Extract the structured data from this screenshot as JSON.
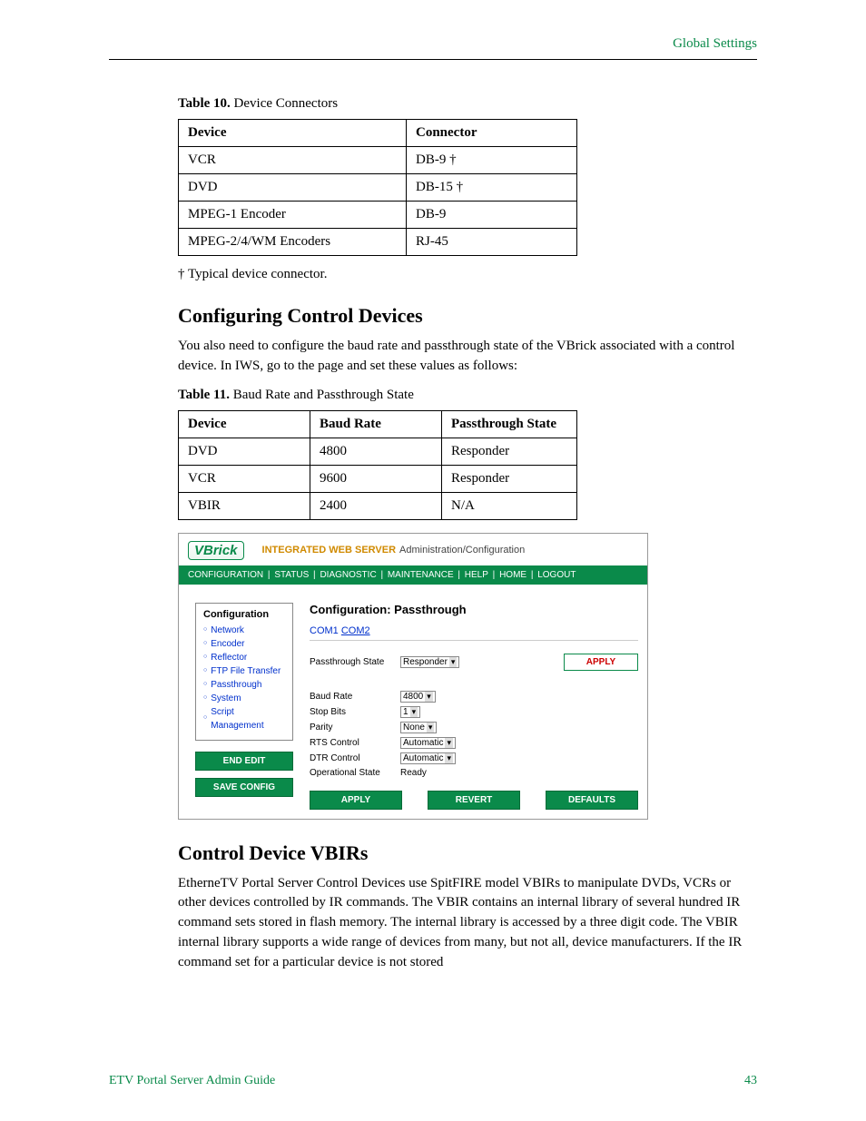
{
  "header": {
    "section": "Global Settings"
  },
  "table10": {
    "caption_prefix": "Table 10.",
    "caption": "Device Connectors",
    "cols": [
      "Device",
      "Connector"
    ],
    "rows": [
      [
        "VCR",
        "DB-9 †"
      ],
      [
        "DVD",
        "DB-15 †"
      ],
      [
        "MPEG-1 Encoder",
        "DB-9"
      ],
      [
        "MPEG-2/4/WM Encoders",
        "RJ-45"
      ]
    ],
    "footnote": "†   Typical device connector."
  },
  "section1": {
    "title": "Configuring Control Devices",
    "para": "You also need to configure the baud rate and passthrough state of the VBrick associated with a control device. In IWS, go to the                                                           page and set these values as follows:"
  },
  "table11": {
    "caption_prefix": "Table 11.",
    "caption": "Baud Rate and Passthrough State",
    "cols": [
      "Device",
      "Baud Rate",
      "Passthrough State"
    ],
    "rows": [
      [
        "DVD",
        "4800",
        "Responder"
      ],
      [
        "VCR",
        "9600",
        "Responder"
      ],
      [
        "VBIR",
        "2400",
        "N/A"
      ]
    ]
  },
  "screenshot": {
    "logo": "VBrick",
    "title1": "INTEGRATED WEB SERVER",
    "title2": "Administration/Configuration",
    "menu": [
      "CONFIGURATION",
      "STATUS",
      "DIAGNOSTIC",
      "MAINTENANCE",
      "HELP",
      "HOME",
      "LOGOUT"
    ],
    "sidebar": {
      "title": "Configuration",
      "items": [
        "Network",
        "Encoder",
        "Reflector",
        "FTP File Transfer",
        "Passthrough",
        "System",
        "Script Management"
      ],
      "btn_end_edit": "END EDIT",
      "btn_save_config": "SAVE CONFIG"
    },
    "main": {
      "heading": "Configuration: Passthrough",
      "tabs": {
        "t1": "COM1",
        "t2": "COM2"
      },
      "pass_label": "Passthrough State",
      "pass_value": "Responder",
      "apply": "APPLY",
      "fields": [
        {
          "label": "Baud Rate",
          "value": "4800",
          "type": "select"
        },
        {
          "label": "Stop Bits",
          "value": "1",
          "type": "select"
        },
        {
          "label": "Parity",
          "value": "None",
          "type": "select"
        },
        {
          "label": "RTS Control",
          "value": "Automatic",
          "type": "select"
        },
        {
          "label": "DTR Control",
          "value": "Automatic",
          "type": "select"
        },
        {
          "label": "Operational State",
          "value": "Ready",
          "type": "text"
        }
      ],
      "btn_apply": "APPLY",
      "btn_revert": "REVERT",
      "btn_defaults": "DEFAULTS"
    }
  },
  "section2": {
    "title": "Control Device VBIRs",
    "para": "EtherneTV Portal Server Control Devices use SpitFIRE model VBIRs to manipulate DVDs, VCRs or other devices controlled by IR commands. The VBIR contains an internal library of several hundred IR command sets stored in flash memory. The internal library is accessed by a three digit code.  The VBIR internal library supports a wide range of devices from many, but not all, device manufacturers. If the IR command set for a particular device is not stored"
  },
  "footer": {
    "left": "ETV Portal Server Admin Guide",
    "right": "43"
  }
}
